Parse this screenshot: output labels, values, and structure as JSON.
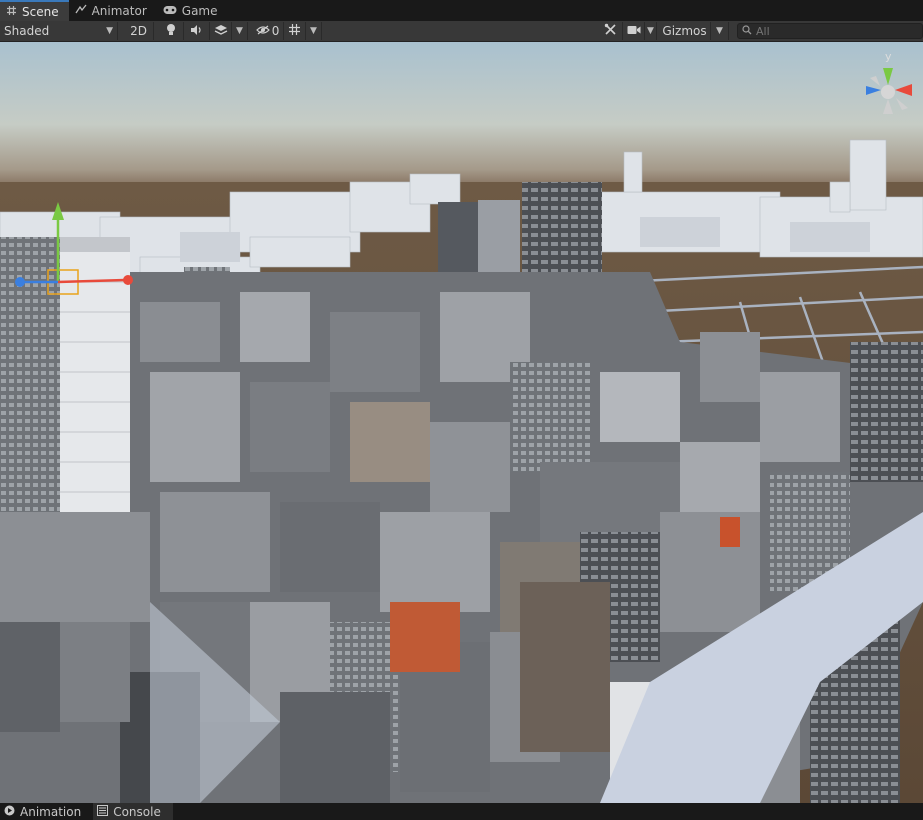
{
  "tabs": [
    {
      "label": "Scene",
      "icon": "grid-icon",
      "active": true
    },
    {
      "label": "Animator",
      "icon": "animator-icon",
      "active": false
    },
    {
      "label": "Game",
      "icon": "gamepad-icon",
      "active": false
    }
  ],
  "toolbar": {
    "draw_mode": "Shaded",
    "mode_2d": "2D",
    "hidden_count": "0",
    "gizmos": "Gizmos",
    "search_placeholder": "All"
  },
  "orientation_gizmo": {
    "y_label": "y"
  },
  "bottom_tabs": [
    {
      "label": "Animation",
      "icon": "play-icon"
    },
    {
      "label": "Console",
      "icon": "console-icon"
    }
  ],
  "colors": {
    "accent": "#3a79bb",
    "ground": "#6e5a45",
    "sky_top": "#a9c1cf"
  }
}
